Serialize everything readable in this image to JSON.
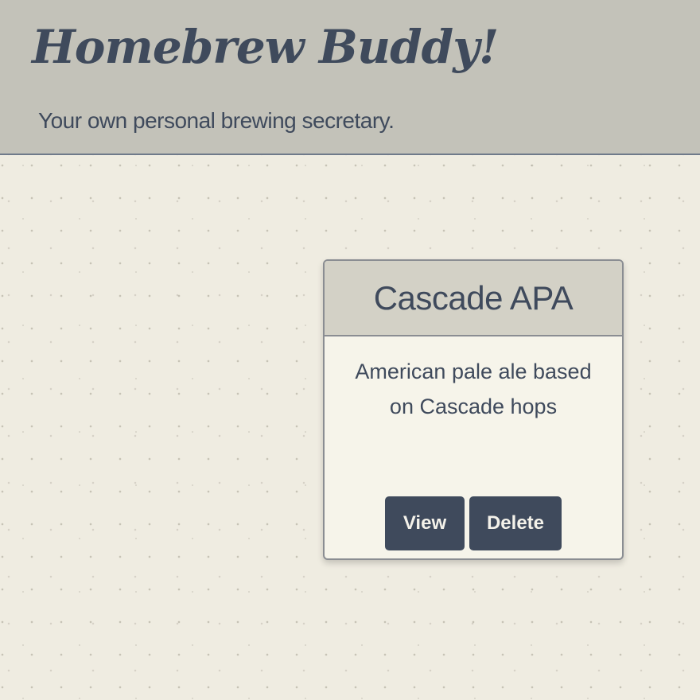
{
  "header": {
    "app_title": "Homebrew Buddy!",
    "subtitle": "Your own personal brewing secretary."
  },
  "recipes": [
    {
      "name": "Cascade APA",
      "description": "American pale ale based on Cascade hops",
      "actions": {
        "view_label": "View",
        "delete_label": "Delete"
      }
    }
  ],
  "colors": {
    "header_background": "#c3c2b9",
    "page_background": "#efece1",
    "text_primary": "#3f4a5c",
    "button_background": "#3f4a5c",
    "button_text": "#f4f2ea",
    "card_background": "#f6f4ea",
    "card_header_background": "#d3d1c6"
  }
}
